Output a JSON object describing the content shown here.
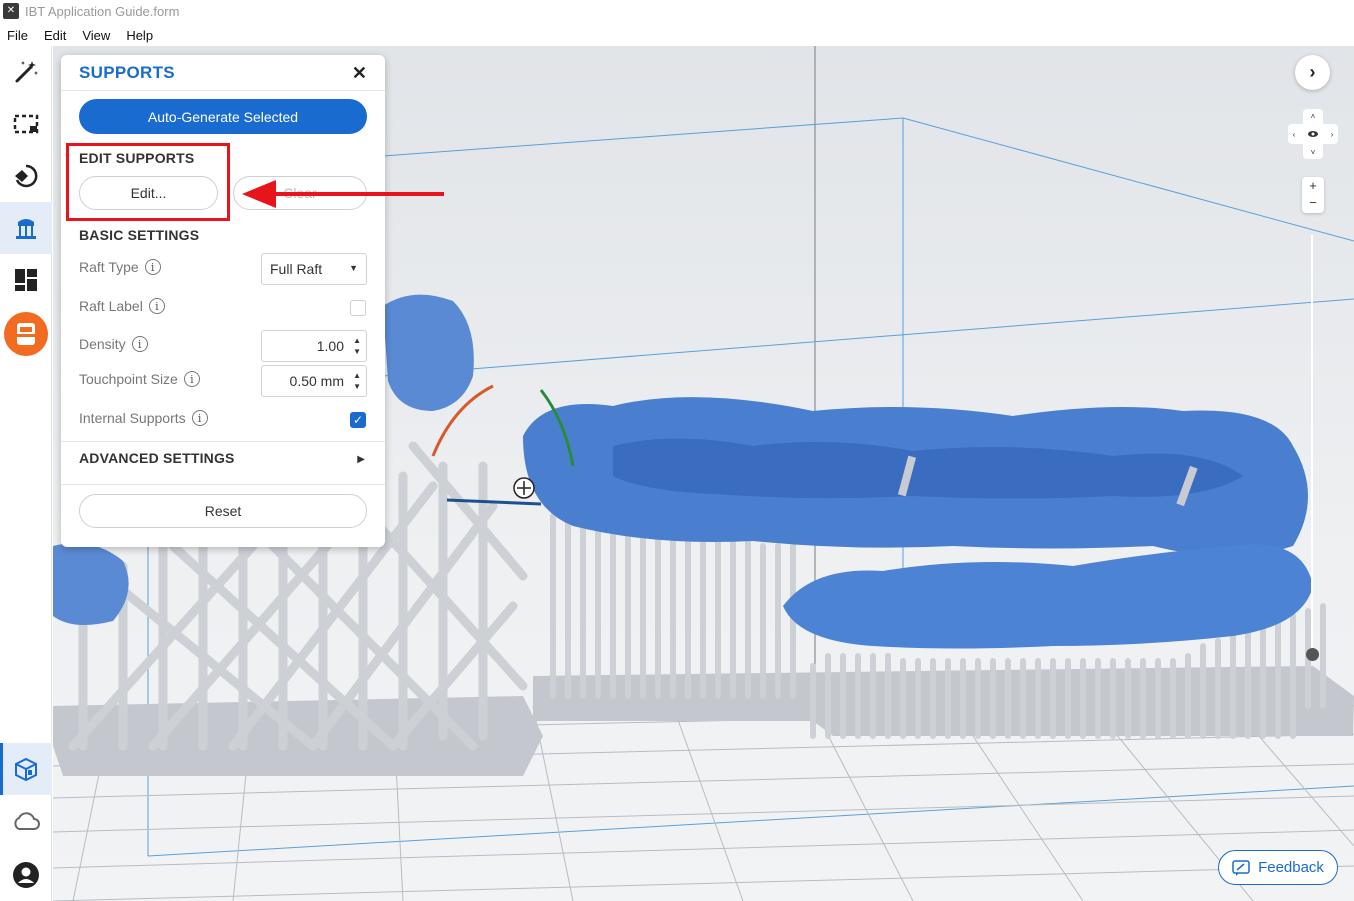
{
  "window": {
    "title": "IBT Application Guide.form",
    "app_icon": "formlabs-preform-icon"
  },
  "menu": [
    "File",
    "Edit",
    "View",
    "Help"
  ],
  "toolbar": {
    "tools": [
      {
        "name": "magic-wand-icon",
        "label": "One-click print"
      },
      {
        "name": "selection-icon",
        "label": "Select"
      },
      {
        "name": "orientation-icon",
        "label": "Orientation"
      },
      {
        "name": "supports-icon",
        "label": "Supports",
        "active": true
      },
      {
        "name": "layout-icon",
        "label": "Layout"
      },
      {
        "name": "print-icon",
        "label": "Print",
        "accent": "#f26b21"
      }
    ],
    "bottom": [
      {
        "name": "model-view-icon",
        "active": true
      },
      {
        "name": "cloud-icon"
      },
      {
        "name": "account-icon"
      }
    ]
  },
  "panel": {
    "title": "SUPPORTS",
    "auto_generate": "Auto-Generate Selected",
    "edit_heading": "EDIT SUPPORTS",
    "edit_button": "Edit...",
    "clear_button": "Clear",
    "basic_heading": "BASIC SETTINGS",
    "raft_type_label": "Raft Type",
    "raft_type_value": "Full Raft",
    "raft_label_label": "Raft Label",
    "raft_label_checked": false,
    "density_label": "Density",
    "density_value": "1.00",
    "touchpoint_label": "Touchpoint Size",
    "touchpoint_value": "0.50 mm",
    "internal_label": "Internal Supports",
    "internal_checked": true,
    "advanced_heading": "ADVANCED SETTINGS",
    "reset_button": "Reset"
  },
  "feedback": {
    "label": "Feedback"
  },
  "colors": {
    "accent": "#1a6bd0",
    "highlight": "#e8141b",
    "model": "#4a7fd0",
    "supports": "#c9cdd3"
  }
}
